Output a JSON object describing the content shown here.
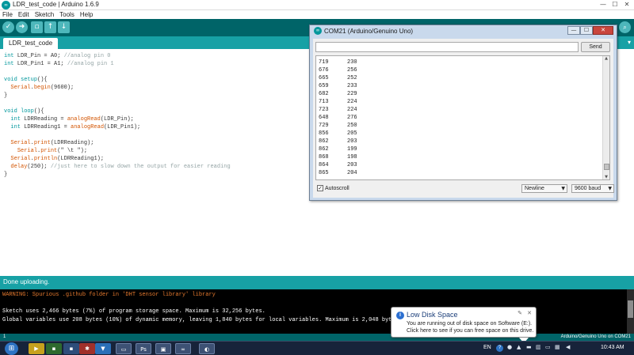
{
  "ide": {
    "window_title": "LDR_test_code | Arduino 1.6.9",
    "menu": [
      "File",
      "Edit",
      "Sketch",
      "Tools",
      "Help"
    ],
    "tab_name": "LDR_test_code",
    "code_lines": [
      [
        {
          "t": "int",
          "c": "kw"
        },
        {
          "t": " LDR_Pin = A0; "
        },
        {
          "t": "//analog pin 0",
          "c": "cm"
        }
      ],
      [
        {
          "t": "int",
          "c": "kw"
        },
        {
          "t": " LDR_Pin1 = A1; "
        },
        {
          "t": "//analog pin 1",
          "c": "cm"
        }
      ],
      [],
      [
        {
          "t": "void",
          "c": "kw"
        },
        {
          "t": " "
        },
        {
          "t": "setup",
          "c": "kw"
        },
        {
          "t": "(){"
        }
      ],
      [
        {
          "t": "  "
        },
        {
          "t": "Serial",
          "c": "fn"
        },
        {
          "t": "."
        },
        {
          "t": "begin",
          "c": "fn"
        },
        {
          "t": "(9600);"
        }
      ],
      [
        {
          "t": "}"
        }
      ],
      [],
      [
        {
          "t": "void",
          "c": "kw"
        },
        {
          "t": " "
        },
        {
          "t": "loop",
          "c": "kw"
        },
        {
          "t": "(){"
        }
      ],
      [
        {
          "t": "  "
        },
        {
          "t": "int",
          "c": "kw"
        },
        {
          "t": " LDRReading = "
        },
        {
          "t": "analogRead",
          "c": "fn"
        },
        {
          "t": "(LDR_Pin);"
        }
      ],
      [
        {
          "t": "  "
        },
        {
          "t": "int",
          "c": "kw"
        },
        {
          "t": " LDRReading1 = "
        },
        {
          "t": "analogRead",
          "c": "fn"
        },
        {
          "t": "(LDR_Pin1);"
        }
      ],
      [],
      [
        {
          "t": "  "
        },
        {
          "t": "Serial",
          "c": "fn"
        },
        {
          "t": "."
        },
        {
          "t": "print",
          "c": "fn"
        },
        {
          "t": "(LDRReading);"
        }
      ],
      [
        {
          "t": "    "
        },
        {
          "t": "Serial",
          "c": "fn"
        },
        {
          "t": "."
        },
        {
          "t": "print",
          "c": "fn"
        },
        {
          "t": "(\" \\t \");"
        }
      ],
      [
        {
          "t": "  "
        },
        {
          "t": "Serial",
          "c": "fn"
        },
        {
          "t": "."
        },
        {
          "t": "println",
          "c": "fn"
        },
        {
          "t": "(LDRReading1);"
        }
      ],
      [
        {
          "t": "  "
        },
        {
          "t": "delay",
          "c": "fn"
        },
        {
          "t": "(250); "
        },
        {
          "t": "//just here to slow down the output for easier reading",
          "c": "cm"
        }
      ],
      [
        {
          "t": "}"
        }
      ]
    ],
    "status_text": "Done uploading.",
    "console_warning": "WARNING: Spurious .github folder in 'DHT sensor library' library",
    "console_lines": [
      "Sketch uses 2,466 bytes (7%) of program storage space. Maximum is 32,256 bytes.",
      "Global variables use 208 bytes (10%) of dynamic memory, leaving 1,840 bytes for local variables. Maximum is 2,048 bytes."
    ],
    "line_number": "1",
    "board_status": "Arduino/Genuino Uno on COM21",
    "colors": {
      "toolbar": "#006468",
      "tabbar": "#17a1a5",
      "keyword": "#00979c",
      "function": "#d35400"
    }
  },
  "serial_monitor": {
    "title": "COM21 (Arduino/Genuino Uno)",
    "input_value": "",
    "send_label": "Send",
    "readings": [
      [
        "719",
        "230"
      ],
      [
        "676",
        "256"
      ],
      [
        "665",
        "252"
      ],
      [
        "659",
        "233"
      ],
      [
        "682",
        "229"
      ],
      [
        "713",
        "224"
      ],
      [
        "723",
        "224"
      ],
      [
        "648",
        "276"
      ],
      [
        "729",
        "250"
      ],
      [
        "856",
        "205"
      ],
      [
        "862",
        "203"
      ],
      [
        "862",
        "199"
      ],
      [
        "868",
        "198"
      ],
      [
        "864",
        "203"
      ],
      [
        "865",
        "204"
      ]
    ],
    "autoscroll_label": "Autoscroll",
    "autoscroll_checked": true,
    "line_ending": "Newline",
    "baud_rate": "9600 baud"
  },
  "notification": {
    "title": "Low Disk Space",
    "line1": "You are running out of disk space on Software (E:).",
    "line2": "Click here to see if you can free space on this drive."
  },
  "taskbar": {
    "language": "EN",
    "time": "10:43 AM",
    "pinned_icons": [
      "media-player-icon",
      "app-icon",
      "app-icon",
      "app-icon",
      "explorer-icon",
      "photoshop-icon",
      "app-icon",
      "arduino-icon",
      "app-icon"
    ]
  }
}
